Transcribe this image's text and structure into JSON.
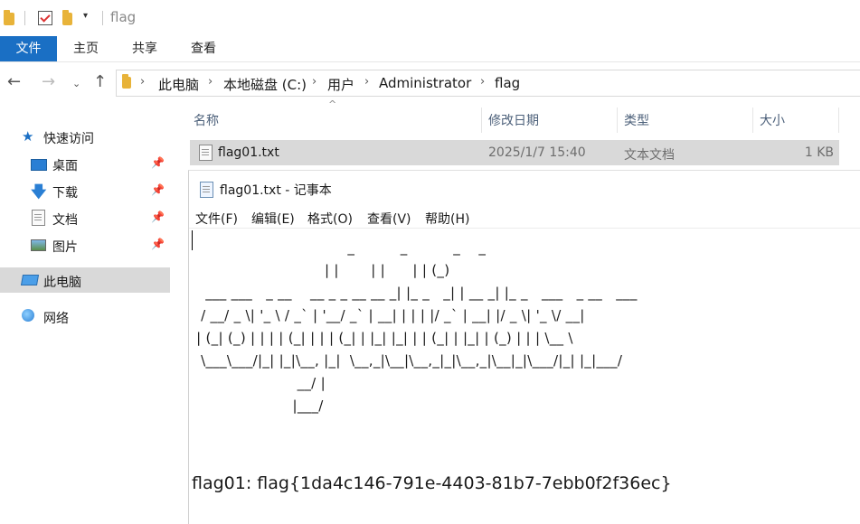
{
  "window": {
    "title": "flag"
  },
  "ribbon": {
    "tabs": [
      "文件",
      "主页",
      "共享",
      "查看"
    ]
  },
  "address": {
    "crumbs": [
      "此电脑",
      "本地磁盘 (C:)",
      "用户",
      "Administrator",
      "flag"
    ]
  },
  "nav": {
    "quick_access": "快速访问",
    "items": [
      "桌面",
      "下载",
      "文档",
      "图片"
    ],
    "this_pc": "此电脑",
    "network": "网络"
  },
  "columns": [
    "名称",
    "修改日期",
    "类型",
    "大小"
  ],
  "files": [
    {
      "name": "flag01.txt",
      "modified": "2025/1/7 15:40",
      "type": "文本文档",
      "size": "1 KB"
    }
  ],
  "notepad": {
    "title": "flag01.txt - 记事本",
    "menu": [
      "文件(F)",
      "编辑(E)",
      "格式(O)",
      "查看(V)",
      "帮助(H)"
    ],
    "ascii_art": "                                  _          _          _    _\n                             | |       | |      | | (_)\n   ___ ___   _ __    __ _ _ __ __ _| |_ _   _| | __ _| |_ _   ___   _ __   ___\n  / __/ _ \\| '_ \\ / _` | '__/ _` | __| | | | |/ _` | __| |/ _ \\| '_ \\/ __|\n | (_| (_) | | | | (_| | | | (_| | |_| |_| | | (_| | |_| | (_) | | | \\__ \\\n  \\___\\___/|_| |_|\\__, |_|  \\__,_|\\__|\\__,_|_|\\__,_|\\__|_|\\___/|_| |_|___/\n                       __/ |\n                      |___/",
    "flag_line": "flag01: flag{1da4c146-791e-4403-81b7-7ebb0f2f36ec}"
  },
  "colors": {
    "accent": "#1a6fc4",
    "selected_row": "#d9d9d9"
  }
}
